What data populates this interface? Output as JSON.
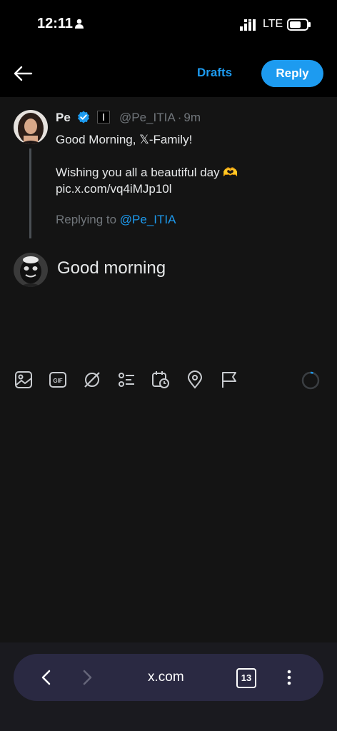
{
  "status_bar": {
    "time": "12:11",
    "network": "LTE"
  },
  "header": {
    "drafts_label": "Drafts",
    "reply_label": "Reply"
  },
  "post": {
    "author_name": "Pe",
    "author_handle": "@Pe_ITIA",
    "time": "9m",
    "text_line1": "Good Morning, 𝕏-Family!",
    "text_line2": "Wishing you all a beautiful day 🫶",
    "text_line3": "pic.x.com/vq4iMJp10l",
    "replying_prefix": "Replying to",
    "replying_handle": "@Pe_ITIA"
  },
  "reply": {
    "text": "Good morning"
  },
  "toolbar": {
    "icons": [
      "image-icon",
      "gif-icon",
      "grok-icon",
      "poll-icon",
      "schedule-icon",
      "location-icon",
      "flag-icon"
    ]
  },
  "browser": {
    "url": "x.com",
    "tab_count": "13"
  },
  "colors": {
    "accent": "#1d9bf0",
    "background": "#141414",
    "muted": "#71767b"
  }
}
